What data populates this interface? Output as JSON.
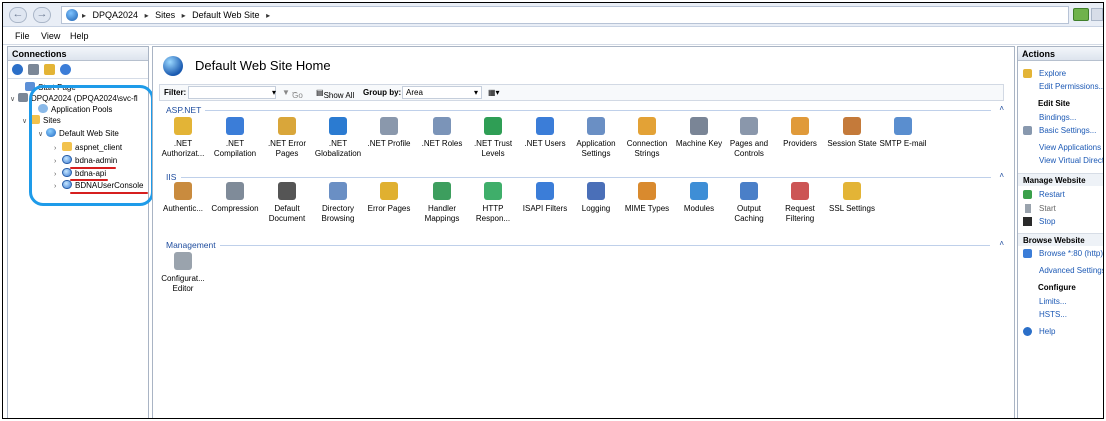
{
  "address": {
    "crumbs": [
      "DPQA2024",
      "Sites",
      "Default Web Site"
    ]
  },
  "menu": [
    "File",
    "View",
    "Help"
  ],
  "connections": {
    "header": "Connections",
    "tree": [
      {
        "label": "Start Page",
        "icon": "home-icon"
      },
      {
        "label": "DPQA2024 (DPQA2024\\svc-fl",
        "icon": "server-icon"
      },
      {
        "label": "Application Pools",
        "icon": "app-pool-icon"
      },
      {
        "label": "Sites",
        "icon": "sites-folder-icon"
      },
      {
        "label": "Default Web Site",
        "icon": "globe-icon"
      },
      {
        "label": "aspnet_client",
        "icon": "folder-icon"
      },
      {
        "label": "bdna-admin",
        "icon": "web-app-icon"
      },
      {
        "label": "bdna-api",
        "icon": "web-app-icon"
      },
      {
        "label": "BDNAUserConsole",
        "icon": "web-app-icon"
      }
    ],
    "highlight_color": "#1e9be9",
    "underline_color": "#d61f1f"
  },
  "content": {
    "title": "Default Web Site Home",
    "filter_label": "Filter:",
    "go_label": "Go",
    "show_all_label": "Show All",
    "group_by_label": "Group by:",
    "group_by_value": "Area",
    "groups": [
      {
        "name": "ASP.NET",
        "features": [
          ".NET\nAuthorizat...",
          ".NET\nCompilation",
          ".NET Error\nPages",
          ".NET\nGlobalization",
          ".NET Profile",
          ".NET Roles",
          ".NET Trust\nLevels",
          ".NET Users",
          "Application\nSettings",
          "Connection\nStrings",
          "Machine Key",
          "Pages and\nControls",
          "Providers",
          "Session State",
          "SMTP E-mail"
        ]
      },
      {
        "name": "IIS",
        "features": [
          "Authentic...",
          "Compression",
          "Default\nDocument",
          "Directory\nBrowsing",
          "Error Pages",
          "Handler\nMappings",
          "HTTP\nRespon...",
          "ISAPI Filters",
          "Logging",
          "MIME Types",
          "Modules",
          "Output\nCaching",
          "Request\nFiltering",
          "SSL Settings"
        ]
      },
      {
        "name": "Management",
        "features": [
          "Configurat...\nEditor"
        ]
      }
    ]
  },
  "actions": {
    "header": "Actions",
    "explore": "Explore",
    "edit_permissions": "Edit Permissions...",
    "edit_site_header": "Edit Site",
    "bindings": "Bindings...",
    "basic_settings": "Basic Settings...",
    "view_applications": "View Applications",
    "view_virtual_dirs": "View Virtual Directories",
    "manage_website_header": "Manage Website",
    "restart": "Restart",
    "start": "Start",
    "stop": "Stop",
    "browse_website_header": "Browse Website",
    "browse_80": "Browse *:80 (http)",
    "advanced_settings": "Advanced Settings...",
    "configure_header": "Configure",
    "limits": "Limits...",
    "hsts": "HSTS...",
    "help": "Help"
  }
}
